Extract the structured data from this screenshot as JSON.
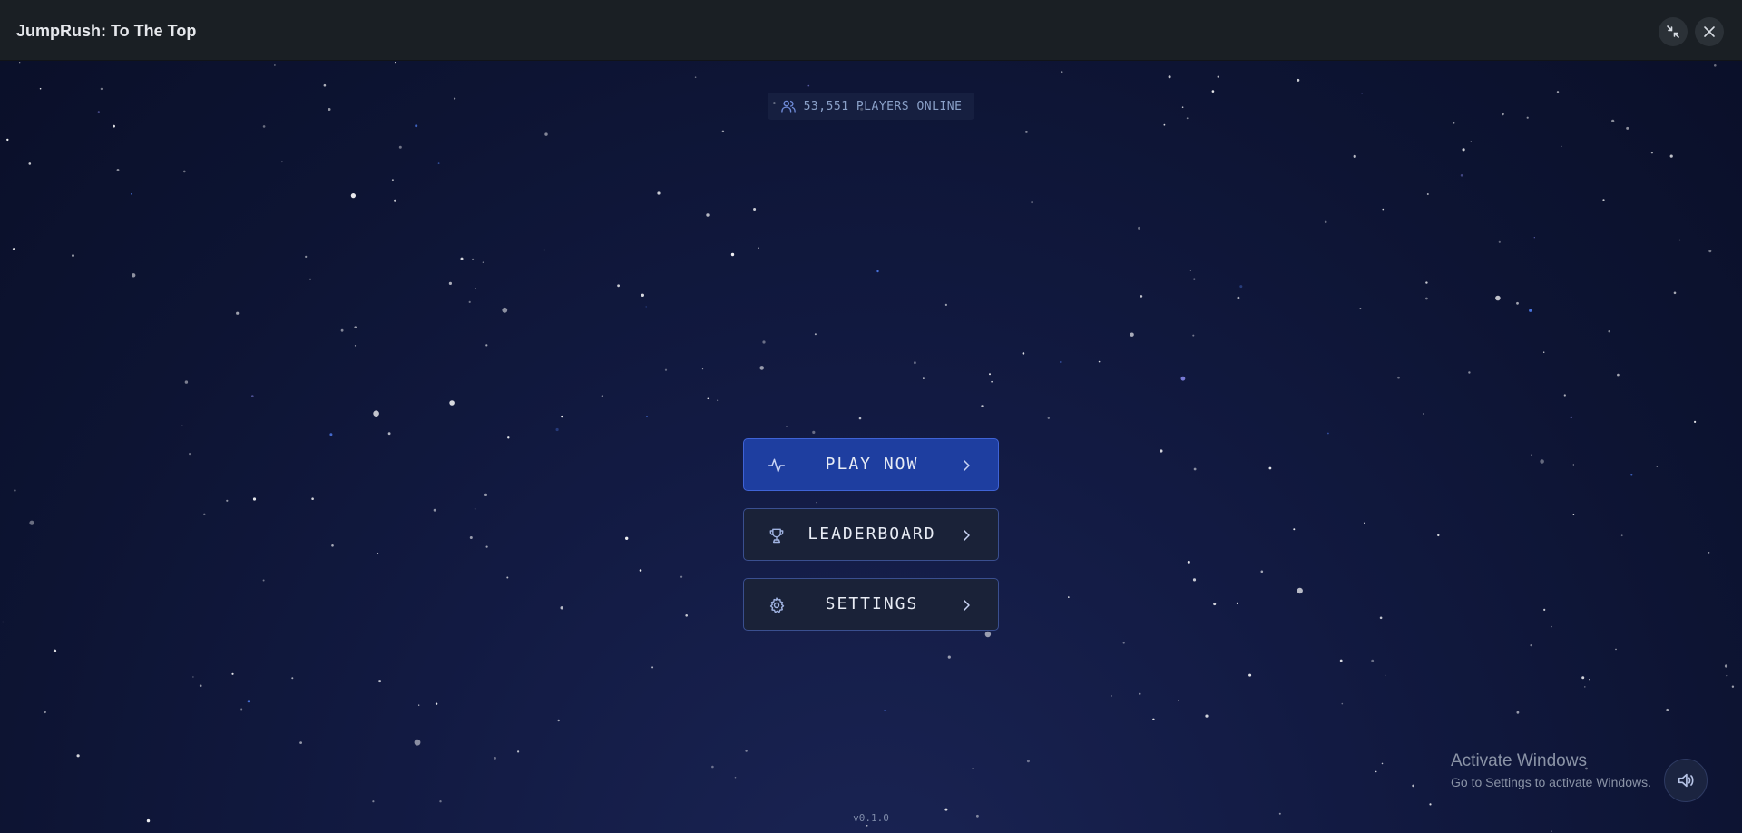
{
  "window": {
    "title": "JumpRush: To The Top",
    "controls": [
      "shrink-icon",
      "close-icon"
    ]
  },
  "status": {
    "players_online": "53,551 PLAYERS ONLINE",
    "icon": "users-icon"
  },
  "menu": {
    "items": [
      {
        "label": "PLAY NOW",
        "icon": "activity-pulse-icon",
        "primary": true
      },
      {
        "label": "LEADERBOARD",
        "icon": "trophy-icon",
        "primary": false
      },
      {
        "label": "SETTINGS",
        "icon": "gear-icon",
        "primary": false
      }
    ]
  },
  "footer": {
    "version": "v0.1.0"
  },
  "watermark": {
    "title": "Activate Windows",
    "subtitle": "Go to Settings to activate Windows."
  },
  "colors": {
    "background": "#0d1433",
    "titlebar": "#1a1f24",
    "primary_button": "#1e3ea0",
    "secondary_button": "#1a2238",
    "button_border": "#3a4f8f",
    "accent_text": "#8aa0c8"
  }
}
